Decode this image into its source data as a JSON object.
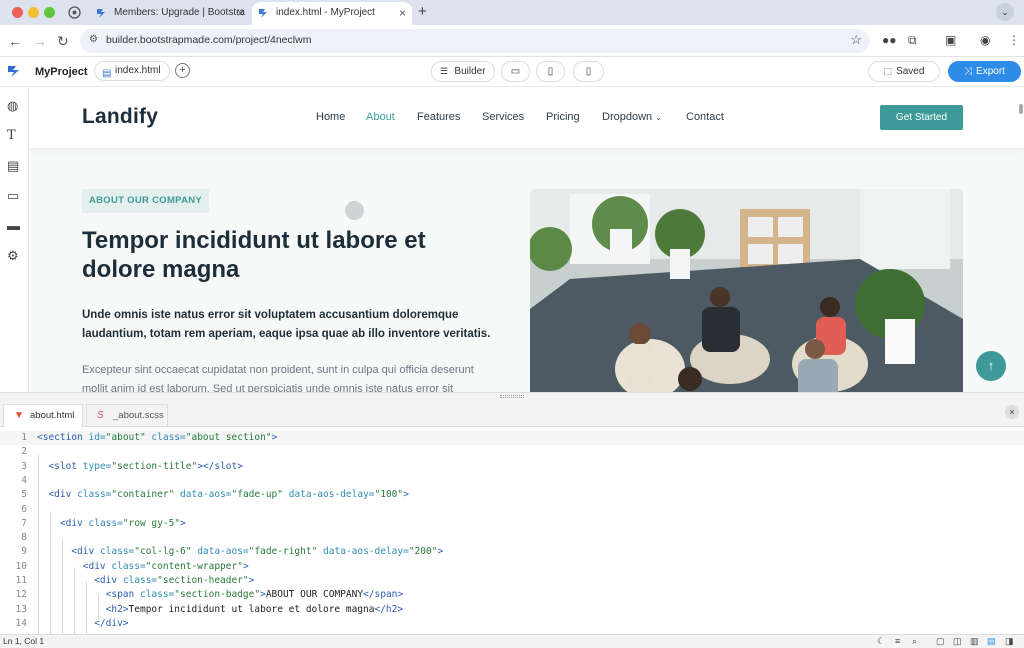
{
  "browser": {
    "tabs": [
      {
        "title": "Members: Upgrade | Bootstra",
        "active": false
      },
      {
        "title": "index.html - MyProject",
        "active": true
      }
    ],
    "url": "builder.bootstrapmade.com/project/4neclwm"
  },
  "builder": {
    "project_name": "MyProject",
    "file_pill": "index.html",
    "mode_label": "Builder",
    "saved_label": "Saved",
    "export_label": "Export"
  },
  "rail_icons": [
    "palette-icon",
    "text-icon",
    "page-icon",
    "section-icon",
    "footer-icon",
    "settings-icon"
  ],
  "site": {
    "brand": "Landify",
    "nav": [
      "Home",
      "About",
      "Features",
      "Services",
      "Pricing",
      "Dropdown",
      "Contact"
    ],
    "active_nav": "About",
    "cta": "Get Started",
    "badge": "ABOUT OUR COMPANY",
    "heading": "Tempor incididunt ut labore et dolore magna",
    "lead": "Unde omnis iste natus error sit voluptatem accusantium doloremque laudantium, totam rem aperiam, eaque ipsa quae ab illo inventore veritatis.",
    "body": "Excepteur sint occaecat cupidatat non proident, sunt in culpa qui officia deserunt mollit anim id est laborum. Sed ut perspiciatis unde omnis iste natus error sit"
  },
  "editor": {
    "tabs": [
      "about.html",
      "_about.scss"
    ],
    "lines": [
      {
        "n": "1",
        "code": [
          [
            "tg",
            "<section "
          ],
          [
            "at",
            "id="
          ],
          [
            "st",
            "\"about\""
          ],
          [
            "at",
            " class="
          ],
          [
            "st",
            "\"about section\""
          ],
          [
            "tg",
            ">"
          ]
        ]
      },
      {
        "n": "2",
        "code": []
      },
      {
        "n": "3",
        "code": [
          [
            "tx",
            "  "
          ],
          [
            "tg",
            "<slot "
          ],
          [
            "at",
            "type="
          ],
          [
            "st",
            "\"section-title\""
          ],
          [
            "tg",
            "></slot>"
          ]
        ]
      },
      {
        "n": "4",
        "code": []
      },
      {
        "n": "5",
        "code": [
          [
            "tx",
            "  "
          ],
          [
            "tg",
            "<div "
          ],
          [
            "at",
            "class="
          ],
          [
            "st",
            "\"container\""
          ],
          [
            "at",
            " data-aos="
          ],
          [
            "st",
            "\"fade-up\""
          ],
          [
            "at",
            " data-aos-delay="
          ],
          [
            "st",
            "\"100\""
          ],
          [
            "tg",
            ">"
          ]
        ]
      },
      {
        "n": "6",
        "code": []
      },
      {
        "n": "7",
        "code": [
          [
            "tx",
            "    "
          ],
          [
            "tg",
            "<div "
          ],
          [
            "at",
            "class="
          ],
          [
            "st",
            "\"row gy-5\""
          ],
          [
            "tg",
            ">"
          ]
        ]
      },
      {
        "n": "8",
        "code": []
      },
      {
        "n": "9",
        "code": [
          [
            "tx",
            "      "
          ],
          [
            "tg",
            "<div "
          ],
          [
            "at",
            "class="
          ],
          [
            "st",
            "\"col-lg-6\""
          ],
          [
            "at",
            " data-aos="
          ],
          [
            "st",
            "\"fade-right\""
          ],
          [
            "at",
            " data-aos-delay="
          ],
          [
            "st",
            "\"200\""
          ],
          [
            "tg",
            ">"
          ]
        ]
      },
      {
        "n": "10",
        "code": [
          [
            "tx",
            "        "
          ],
          [
            "tg",
            "<div "
          ],
          [
            "at",
            "class="
          ],
          [
            "st",
            "\"content-wrapper\""
          ],
          [
            "tg",
            ">"
          ]
        ]
      },
      {
        "n": "11",
        "code": [
          [
            "tx",
            "          "
          ],
          [
            "tg",
            "<div "
          ],
          [
            "at",
            "class="
          ],
          [
            "st",
            "\"section-header\""
          ],
          [
            "tg",
            ">"
          ]
        ]
      },
      {
        "n": "12",
        "code": [
          [
            "tx",
            "            "
          ],
          [
            "tg",
            "<span "
          ],
          [
            "at",
            "class="
          ],
          [
            "st",
            "\"section-badge\""
          ],
          [
            "tg",
            ">"
          ],
          [
            "tx",
            "ABOUT OUR COMPANY"
          ],
          [
            "tg",
            "</span>"
          ]
        ]
      },
      {
        "n": "13",
        "code": [
          [
            "tx",
            "            "
          ],
          [
            "tg",
            "<h2>"
          ],
          [
            "tx",
            "Tempor incididunt ut labore et dolore magna"
          ],
          [
            "tg",
            "</h2>"
          ]
        ]
      },
      {
        "n": "14",
        "code": [
          [
            "tx",
            "          "
          ],
          [
            "tg",
            "</div>"
          ]
        ]
      }
    ]
  },
  "status": {
    "cursor": "Ln 1, Col 1"
  }
}
